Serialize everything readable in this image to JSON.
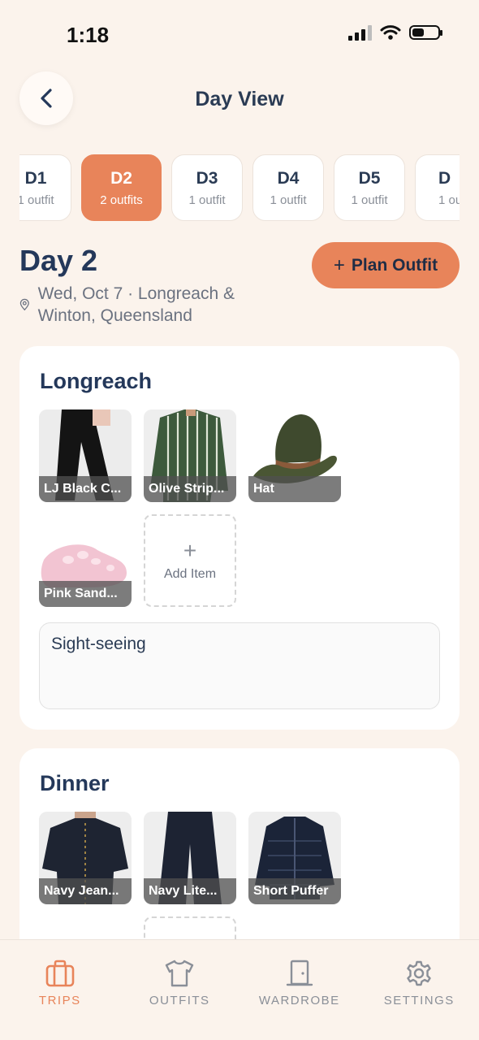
{
  "status_bar": {
    "time": "1:18"
  },
  "header": {
    "title": "Day View",
    "back_icon": "chevron-left-icon"
  },
  "day_tabs": [
    {
      "day": "D1",
      "count": "1 outfit",
      "active": false
    },
    {
      "day": "D2",
      "count": "2 outfits",
      "active": true
    },
    {
      "day": "D3",
      "count": "1 outfit",
      "active": false
    },
    {
      "day": "D4",
      "count": "1 outfit",
      "active": false
    },
    {
      "day": "D5",
      "count": "1 outfit",
      "active": false
    },
    {
      "day": "D",
      "count": "1 ou",
      "active": false
    }
  ],
  "day": {
    "heading": "Day 2",
    "location": "Wed, Oct 7 · Longreach & Winton, Queensland",
    "plan_button": "Plan Outfit"
  },
  "outfits": [
    {
      "title": "Longreach",
      "items": [
        {
          "label": "LJ Black C...",
          "icon": "pants-icon"
        },
        {
          "label": "Olive Strip...",
          "icon": "shirt-icon"
        },
        {
          "label": "Hat",
          "icon": "hat-icon"
        },
        {
          "label": "Pink Sand...",
          "icon": "sandal-icon"
        }
      ],
      "add_item_label": "Add Item",
      "notes": "Sight-seeing"
    },
    {
      "title": "Dinner",
      "items": [
        {
          "label": "Navy Jean...",
          "icon": "shirt-icon"
        },
        {
          "label": "Navy Lite...",
          "icon": "pants-icon"
        },
        {
          "label": "Short Puffer",
          "icon": "jacket-icon"
        }
      ]
    }
  ],
  "tab_bar": [
    {
      "label": "TRIPS",
      "icon": "suitcase-icon",
      "active": true
    },
    {
      "label": "OUTFITS",
      "icon": "tshirt-icon",
      "active": false
    },
    {
      "label": "WARDROBE",
      "icon": "door-icon",
      "active": false
    },
    {
      "label": "SETTINGS",
      "icon": "gear-icon",
      "active": false
    }
  ],
  "colors": {
    "accent": "#e8845a",
    "navy": "#24385a",
    "background": "#fbf3ec"
  }
}
